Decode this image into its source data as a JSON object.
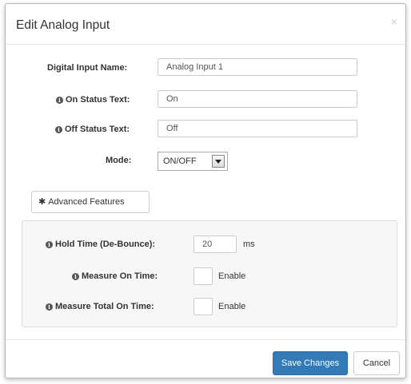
{
  "dialog": {
    "title": "Edit Analog Input",
    "close_symbol": "×"
  },
  "fields": {
    "name_label": "Digital Input Name:",
    "name_value": "Analog Input 1",
    "on_label": "On Status Text:",
    "on_value": "On",
    "off_label": "Off Status Text:",
    "off_value": "Off",
    "mode_label": "Mode:",
    "mode_value": "ON/OFF"
  },
  "advanced": {
    "button_label": "Advanced Features",
    "hold_time_label": "Hold Time (De-Bounce):",
    "hold_time_value": "20",
    "hold_time_unit": "ms",
    "measure_on_label": "Measure On Time:",
    "measure_on_checkbox_label": "Enable",
    "measure_total_label": "Measure Total On Time:",
    "measure_total_checkbox_label": "Enable"
  },
  "footer": {
    "save_label": "Save Changes",
    "cancel_label": "Cancel"
  },
  "icons": {
    "info": "info-icon",
    "gear": "gear-icon",
    "close": "close-icon",
    "dropdown": "chevron-down-icon"
  },
  "colors": {
    "primary": "#337ab7",
    "panel_bg": "#f7f7f7"
  }
}
